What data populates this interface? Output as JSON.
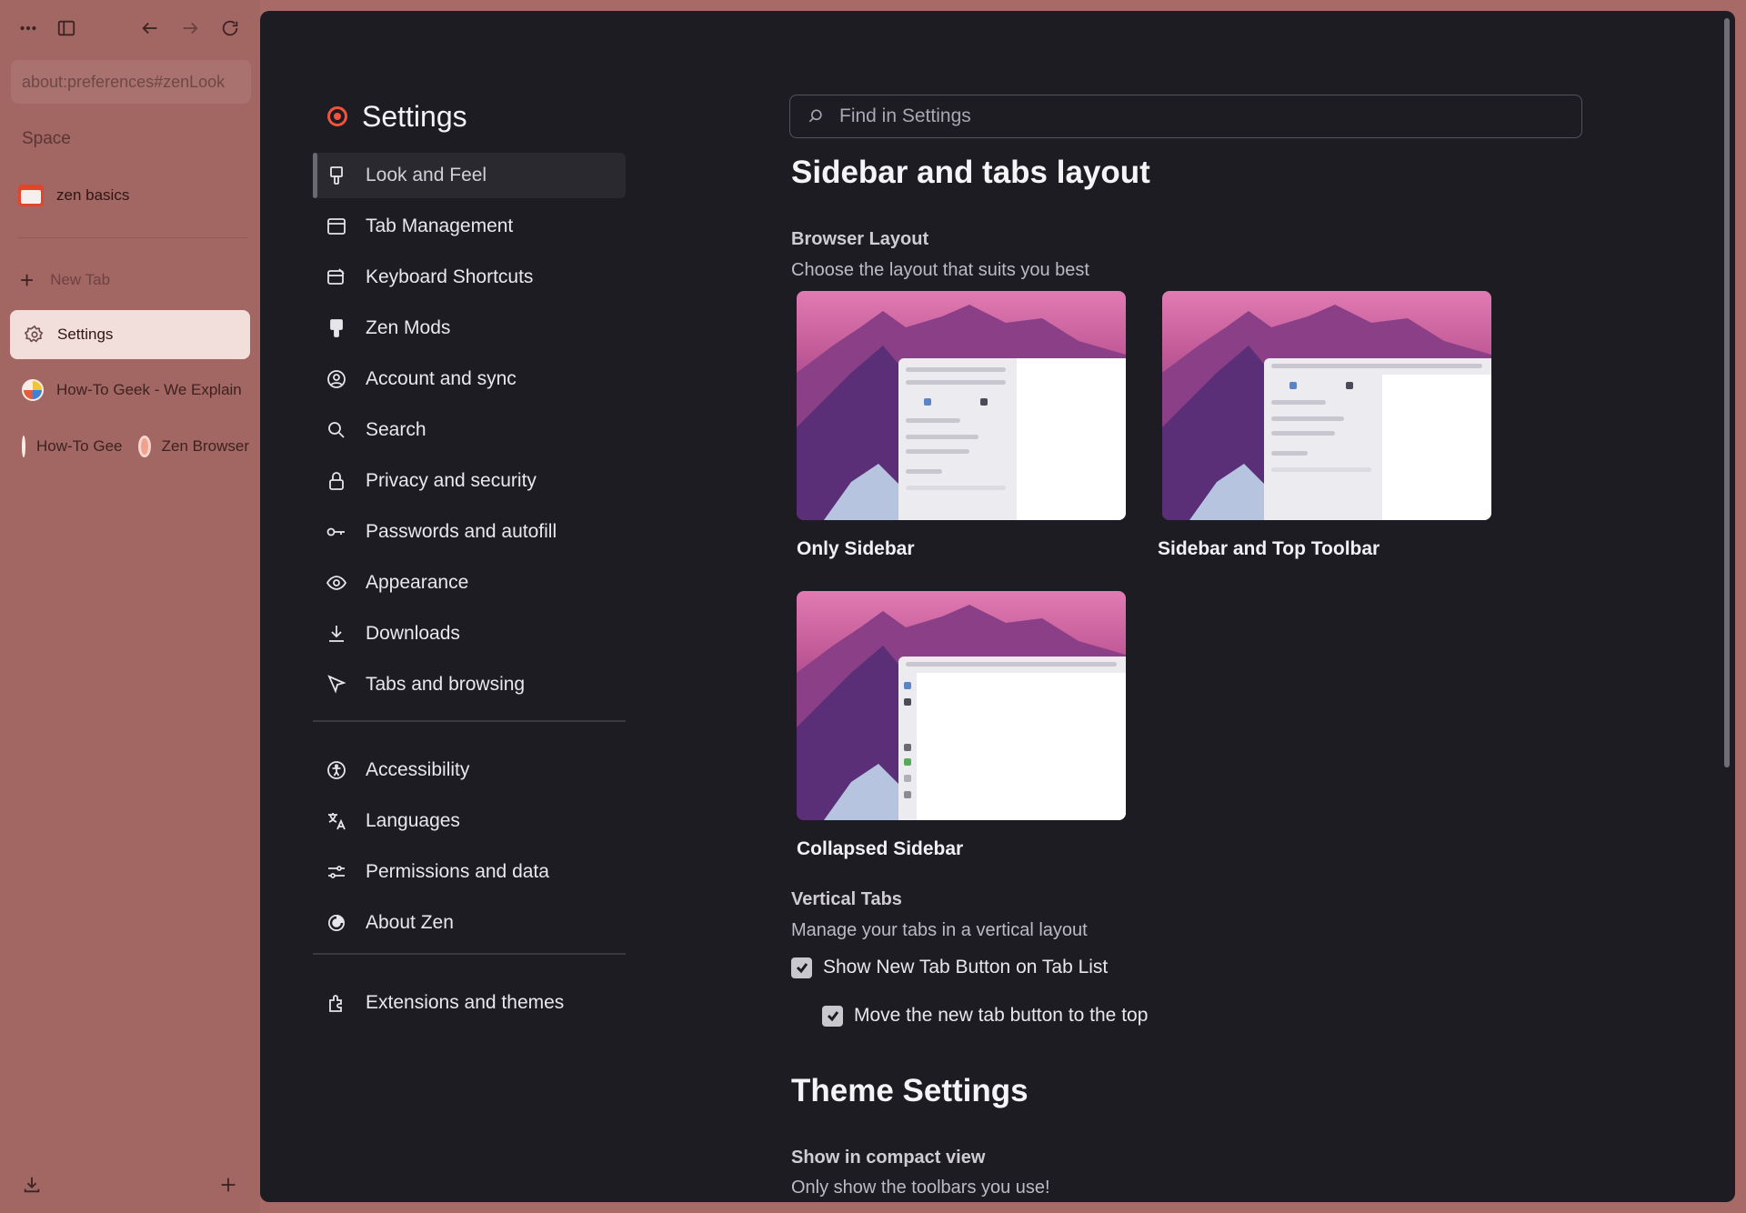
{
  "browser_sidebar": {
    "url": "about:preferences#zenLook",
    "space_label": "Space",
    "workspace_name": "zen basics",
    "new_tab_label": "New Tab",
    "active_tab_label": "Settings",
    "tabs": [
      {
        "label": "How-To Geek - We Explain"
      }
    ],
    "split_tabs": [
      {
        "label": "How-To Geek"
      },
      {
        "label": "Zen Browser"
      }
    ]
  },
  "settings": {
    "title": "Settings",
    "search_placeholder": "Find in Settings",
    "nav": {
      "primary": [
        {
          "label": "Look and Feel",
          "icon": "paintbrush-icon"
        },
        {
          "label": "Tab Management",
          "icon": "window-icon"
        },
        {
          "label": "Keyboard Shortcuts",
          "icon": "keyboard-edit-icon"
        },
        {
          "label": "Zen Mods",
          "icon": "brush-icon"
        },
        {
          "label": "Account and sync",
          "icon": "account-icon"
        },
        {
          "label": "Search",
          "icon": "search-icon"
        },
        {
          "label": "Privacy and security",
          "icon": "lock-icon"
        },
        {
          "label": "Passwords and autofill",
          "icon": "key-icon"
        },
        {
          "label": "Appearance",
          "icon": "eye-icon"
        },
        {
          "label": "Downloads",
          "icon": "download-icon"
        },
        {
          "label": "Tabs and browsing",
          "icon": "cursor-icon"
        }
      ],
      "secondary": [
        {
          "label": "Accessibility",
          "icon": "accessibility-icon"
        },
        {
          "label": "Languages",
          "icon": "translate-icon"
        },
        {
          "label": "Permissions and data",
          "icon": "sliders-icon"
        },
        {
          "label": "About Zen",
          "icon": "zen-logo-icon"
        }
      ],
      "tertiary": [
        {
          "label": "Extensions and themes",
          "icon": "puzzle-icon"
        }
      ],
      "selected": "Look and Feel"
    },
    "main": {
      "section_title": "Sidebar and tabs layout",
      "browser_layout": {
        "heading": "Browser Layout",
        "description": "Choose the layout that suits you best",
        "options": [
          {
            "label": "Only Sidebar"
          },
          {
            "label": "Sidebar and Top Toolbar"
          },
          {
            "label": "Collapsed Sidebar"
          }
        ]
      },
      "vertical_tabs": {
        "heading": "Vertical Tabs",
        "description": "Manage your tabs in a vertical layout",
        "show_new_tab_button": {
          "label": "Show New Tab Button on Tab List",
          "checked": true
        },
        "move_new_tab_top": {
          "label": "Move the new tab button to the top",
          "checked": true
        }
      },
      "theme_settings": {
        "title": "Theme Settings",
        "compact_heading": "Show in compact view",
        "compact_description": "Only show the toolbars you use!"
      }
    }
  },
  "colors": {
    "sidebar_bg": "#a26763",
    "content_bg": "#1d1c22",
    "accent": "#f2533f"
  }
}
